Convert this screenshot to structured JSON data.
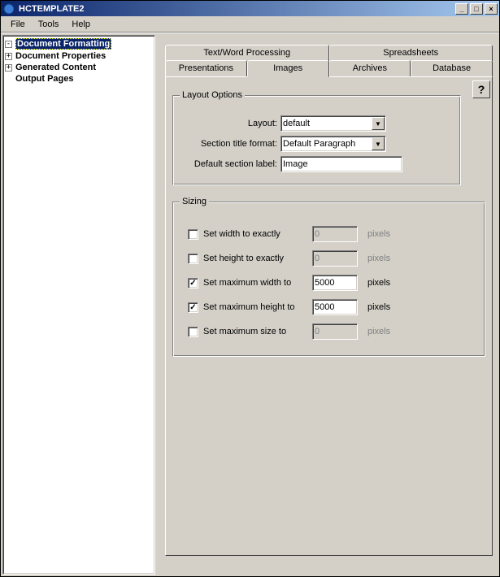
{
  "window": {
    "title": "HCTEMPLATE2"
  },
  "menu": {
    "file": "File",
    "tools": "Tools",
    "help": "Help"
  },
  "sidebar": {
    "items": [
      {
        "label": "Document Formatting",
        "selected": true,
        "expander": "-"
      },
      {
        "label": "Document Properties",
        "selected": false,
        "expander": "+"
      },
      {
        "label": "Generated Content",
        "selected": false,
        "expander": "+"
      },
      {
        "label": "Output Pages",
        "selected": false,
        "expander": ""
      }
    ]
  },
  "tabs": {
    "row1": [
      "Text/Word Processing",
      "Spreadsheets"
    ],
    "row2": [
      "Presentations",
      "Images",
      "Archives",
      "Database"
    ],
    "active": "Images"
  },
  "help_btn": "?",
  "layout_options": {
    "legend": "Layout Options",
    "layout_label": "Layout:",
    "layout_value": "default",
    "section_title_label": "Section title format:",
    "section_title_value": "Default Paragraph",
    "default_section_label": "Default section label:",
    "default_section_value": "Image"
  },
  "sizing": {
    "legend": "Sizing",
    "rows": [
      {
        "label": "Set width to exactly",
        "checked": false,
        "value": "0",
        "unit": "pixels"
      },
      {
        "label": "Set height to exactly",
        "checked": false,
        "value": "0",
        "unit": "pixels"
      },
      {
        "label": "Set maximum width to",
        "checked": true,
        "value": "5000",
        "unit": "pixels"
      },
      {
        "label": "Set maximum height to",
        "checked": true,
        "value": "5000",
        "unit": "pixels"
      },
      {
        "label": "Set maximum size to",
        "checked": false,
        "value": "0",
        "unit": "pixels"
      }
    ]
  }
}
